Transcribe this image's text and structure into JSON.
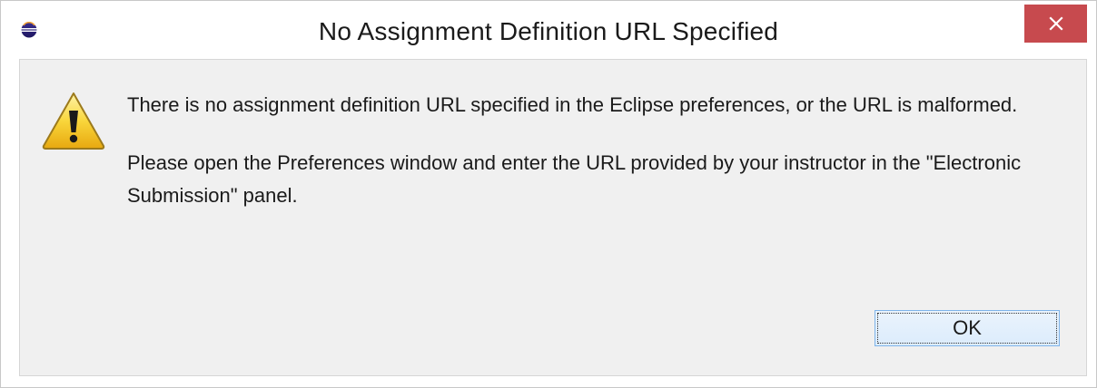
{
  "window": {
    "title": "No Assignment Definition URL Specified",
    "close_icon": "close-icon",
    "app_icon": "eclipse-icon"
  },
  "message": {
    "icon": "warning-icon",
    "paragraph1": "There is no assignment definition URL specified in the Eclipse preferences, or the URL is malformed.",
    "paragraph2": "Please open the Preferences window and enter the URL provided by your instructor in the \"Electronic Submission\" panel."
  },
  "buttons": {
    "ok_label": "OK"
  },
  "colors": {
    "close_button": "#c74a4e",
    "dialog_background": "#f0f0f0",
    "default_button_border": "#7eb4ea"
  }
}
